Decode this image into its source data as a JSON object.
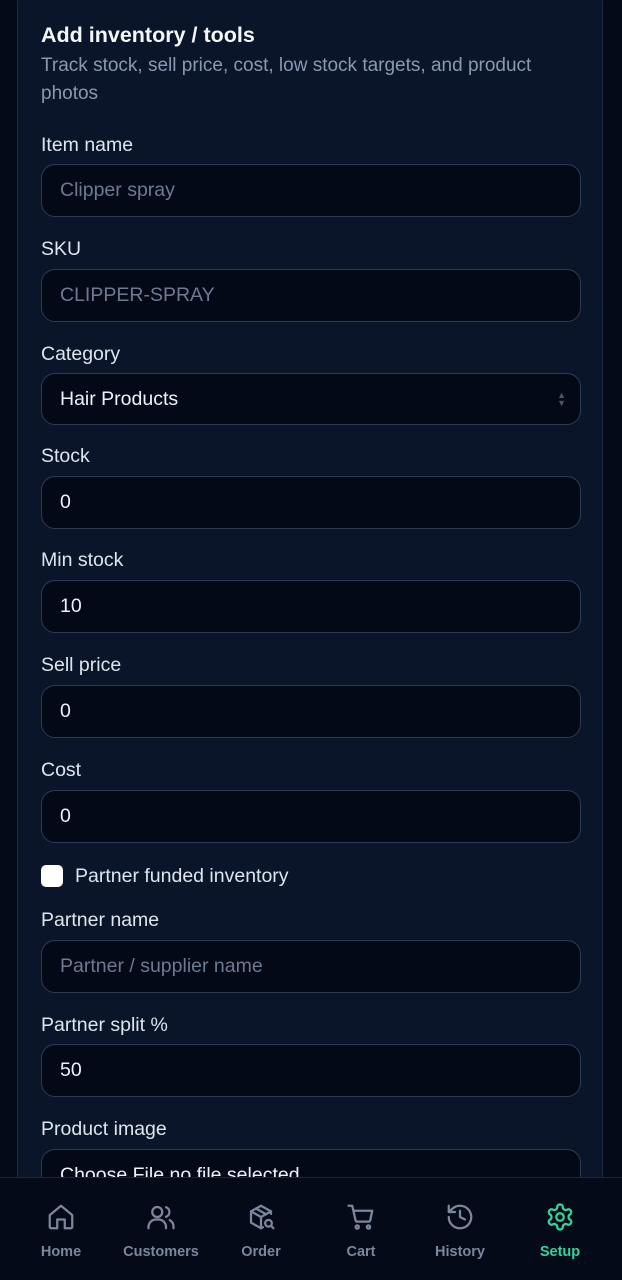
{
  "form": {
    "title": "Add inventory / tools",
    "subtitle": "Track stock, sell price, cost, low stock targets, and product photos",
    "item_name": {
      "label": "Item name",
      "placeholder": "Clipper spray"
    },
    "sku": {
      "label": "SKU",
      "placeholder": "CLIPPER-SPRAY"
    },
    "category": {
      "label": "Category",
      "value": "Hair Products"
    },
    "stock": {
      "label": "Stock",
      "value": "0"
    },
    "min_stock": {
      "label": "Min stock",
      "value": "10"
    },
    "sell_price": {
      "label": "Sell price",
      "value": "0"
    },
    "cost": {
      "label": "Cost",
      "value": "0"
    },
    "partner_funded": {
      "label": "Partner funded inventory",
      "checked": false
    },
    "partner_name": {
      "label": "Partner name",
      "placeholder": "Partner / supplier name"
    },
    "partner_split": {
      "label": "Partner split %",
      "value": "50"
    },
    "product_image": {
      "label": "Product image",
      "value": "Choose File no file selected"
    }
  },
  "nav": {
    "items": [
      {
        "label": "Home",
        "icon": "home-icon"
      },
      {
        "label": "Customers",
        "icon": "users-icon"
      },
      {
        "label": "Order",
        "icon": "package-search-icon"
      },
      {
        "label": "Cart",
        "icon": "cart-icon"
      },
      {
        "label": "History",
        "icon": "history-icon"
      },
      {
        "label": "Setup",
        "icon": "gear-icon",
        "active": true
      }
    ],
    "inactive_color": "#7b879c",
    "active_color": "#34d39c"
  }
}
